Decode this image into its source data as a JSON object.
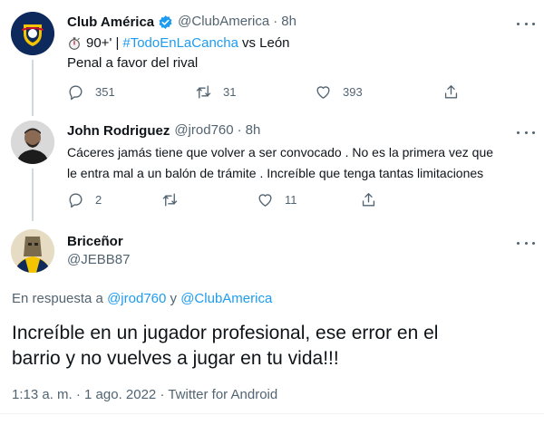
{
  "tweet1": {
    "name": "Club América",
    "verified": true,
    "handle": "@ClubAmerica",
    "separator": "·",
    "time": "8h",
    "line1_prefix": "90+' |",
    "hashtag": "#TodoEnLaCancha",
    "line1_suffix": "vs León",
    "line2": "Penal a favor del rival",
    "replies": "351",
    "retweets": "31",
    "likes": "393"
  },
  "tweet2": {
    "name": "John Rodriguez",
    "handle": "@jrod760",
    "separator": "·",
    "time": "8h",
    "text_line1": "Cáceres jamás tiene que volver a ser convocado . No es la primera vez que",
    "text_line2": "le entra mal a un balón de trámite . Increíble que tenga tantas limitaciones",
    "replies": "2",
    "retweets": "",
    "likes": "11"
  },
  "main_tweet": {
    "name": "Briceñor",
    "handle": "@JEBB87",
    "reply_prefix": "En respuesta a",
    "reply_user1": "@jrod760",
    "reply_conj": "y",
    "reply_user2": "@ClubAmerica",
    "text_line1": "Increíble en un jugador profesional, ese error en el",
    "text_line2": "barrio y no vuelves a jugar en tu vida!!!",
    "meta": "1:13 a. m. · 1 ago. 2022 · Twitter for Android"
  },
  "colors": {
    "accent": "#1d9bf0",
    "text": "#0f1419",
    "muted": "#536471",
    "club_navy": "#0e2a5c",
    "club_gold": "#f5c400"
  }
}
